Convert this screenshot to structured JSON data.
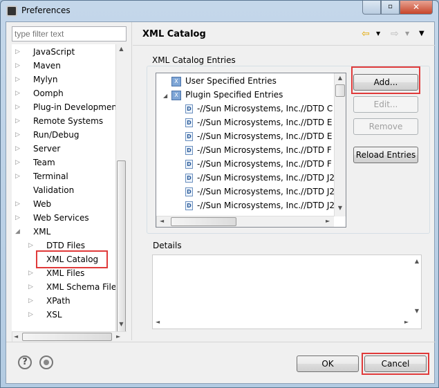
{
  "window": {
    "title": "Preferences"
  },
  "filter": {
    "placeholder": "type filter text"
  },
  "tree": [
    {
      "label": "JavaScript",
      "exp": "collapsed",
      "lvl": 0
    },
    {
      "label": "Maven",
      "exp": "collapsed",
      "lvl": 0
    },
    {
      "label": "Mylyn",
      "exp": "collapsed",
      "lvl": 0
    },
    {
      "label": "Oomph",
      "exp": "collapsed",
      "lvl": 0
    },
    {
      "label": "Plug-in Development",
      "exp": "collapsed",
      "lvl": 0
    },
    {
      "label": "Remote Systems",
      "exp": "collapsed",
      "lvl": 0
    },
    {
      "label": "Run/Debug",
      "exp": "collapsed",
      "lvl": 0
    },
    {
      "label": "Server",
      "exp": "collapsed",
      "lvl": 0
    },
    {
      "label": "Team",
      "exp": "collapsed",
      "lvl": 0
    },
    {
      "label": "Terminal",
      "exp": "collapsed",
      "lvl": 0
    },
    {
      "label": "Validation",
      "exp": "none",
      "lvl": 0
    },
    {
      "label": "Web",
      "exp": "collapsed",
      "lvl": 0
    },
    {
      "label": "Web Services",
      "exp": "collapsed",
      "lvl": 0
    },
    {
      "label": "XML",
      "exp": "expanded",
      "lvl": 0
    },
    {
      "label": "DTD Files",
      "exp": "collapsed",
      "lvl": 1
    },
    {
      "label": "XML Catalog",
      "exp": "none",
      "lvl": 1,
      "selected": true
    },
    {
      "label": "XML Files",
      "exp": "collapsed",
      "lvl": 1
    },
    {
      "label": "XML Schema Files",
      "exp": "collapsed",
      "lvl": 1
    },
    {
      "label": "XPath",
      "exp": "collapsed",
      "lvl": 1
    },
    {
      "label": "XSL",
      "exp": "collapsed",
      "lvl": 1
    }
  ],
  "page": {
    "title": "XML Catalog"
  },
  "entries": {
    "group_label": "XML Catalog Entries",
    "roots": [
      "User Specified Entries",
      "Plugin Specified Entries"
    ],
    "items": [
      "-//Sun Microsystems, Inc.//DTD C",
      "-//Sun Microsystems, Inc.//DTD E",
      "-//Sun Microsystems, Inc.//DTD E",
      "-//Sun Microsystems, Inc.//DTD F",
      "-//Sun Microsystems, Inc.//DTD F",
      "-//Sun Microsystems, Inc.//DTD J2",
      "-//Sun Microsystems, Inc.//DTD J2",
      "-//Sun Microsystems, Inc.//DTD J2"
    ]
  },
  "buttons": {
    "add": "Add...",
    "edit": "Edit...",
    "remove": "Remove",
    "reload": "Reload Entries",
    "ok": "OK",
    "cancel": "Cancel"
  },
  "details": {
    "label": "Details"
  },
  "colors": {
    "highlight": "#e03a3a"
  }
}
